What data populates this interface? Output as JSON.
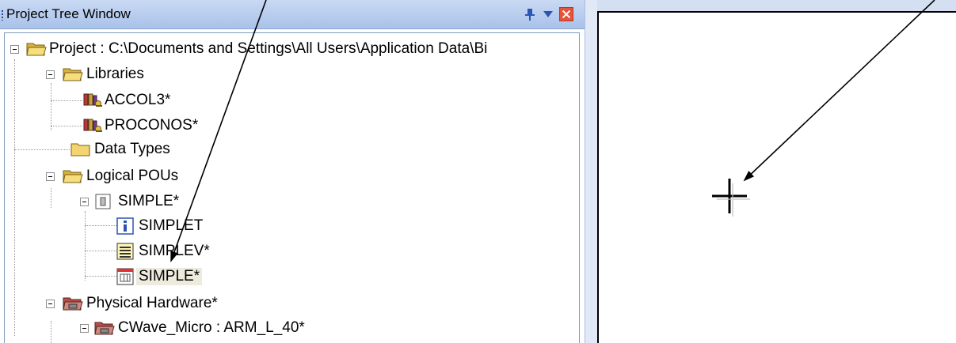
{
  "window": {
    "title": "Project Tree Window"
  },
  "tree": [
    {
      "label": "Project : C:\\Documents and Settings\\All Users\\Application Data\\Bi",
      "icon": "folder-open-icon"
    },
    {
      "label": "Libraries",
      "icon": "folder-open-icon"
    },
    {
      "label": "ACCOL3*",
      "icon": "library-icon"
    },
    {
      "label": "PROCONOS*",
      "icon": "library-icon"
    },
    {
      "label": "Data Types",
      "icon": "folder-icon"
    },
    {
      "label": "Logical POUs",
      "icon": "folder-open-icon"
    },
    {
      "label": "SIMPLE*",
      "icon": "pou-icon"
    },
    {
      "label": "SIMPLET",
      "icon": "info-icon"
    },
    {
      "label": "SIMPLEV*",
      "icon": "variables-icon"
    },
    {
      "label": "SIMPLE*",
      "icon": "code-worksheet-icon",
      "selected": true
    },
    {
      "label": "Physical Hardware*",
      "icon": "hardware-folder-icon"
    },
    {
      "label": "CWave_Micro : ARM_L_40*",
      "icon": "hardware-folder-icon"
    }
  ],
  "icons": {
    "titlebar": [
      "grip-icon",
      "pin-icon",
      "dropdown-icon",
      "close-icon"
    ],
    "canvas": "crosshair-cursor-icon",
    "annotations": [
      "annotation-arrow-to-simplev",
      "annotation-arrow-to-crosshair"
    ]
  },
  "colors": {
    "titlebar": "#b7cdef",
    "close": "#e5533b",
    "selection": "#ecebde",
    "folder": "#f3d46e"
  }
}
